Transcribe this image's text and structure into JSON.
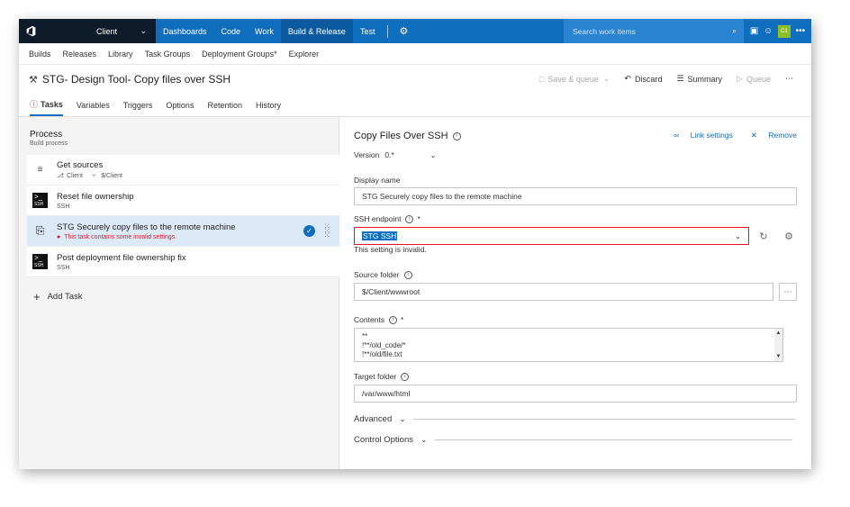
{
  "topbar": {
    "account": "Client",
    "nav": [
      "Dashboards",
      "Code",
      "Work",
      "Build & Release",
      "Test"
    ],
    "active_nav": "Build & Release",
    "search_placeholder": "Search work items",
    "avatar_initials": "C1"
  },
  "subnav": [
    "Builds",
    "Releases",
    "Library",
    "Task Groups",
    "Deployment Groups*",
    "Explorer"
  ],
  "definition": {
    "title": "STG- Design Tool- Copy files over SSH",
    "actions": {
      "save_queue": "Save & queue",
      "discard": "Discard",
      "summary": "Summary",
      "queue": "Queue"
    }
  },
  "tabs": [
    "Tasks",
    "Variables",
    "Triggers",
    "Options",
    "Retention",
    "History"
  ],
  "process": {
    "title": "Process",
    "subtitle": "Build process"
  },
  "tasks": [
    {
      "name": "Get sources",
      "sub_left": "Client",
      "sub_right": "$/Client"
    },
    {
      "name": "Reset file ownership",
      "sub": "SSH"
    },
    {
      "name": "STG Securely copy files to the remote machine",
      "error": "This task contains some invalid settings."
    },
    {
      "name": "Post deployment file ownership fix",
      "sub": "SSH"
    }
  ],
  "add_task": "Add Task",
  "detail": {
    "title": "Copy Files Over SSH",
    "link_settings": "Link settings",
    "remove": "Remove",
    "version_label": "Version",
    "version_value": "0.*",
    "display_name_label": "Display name",
    "display_name_value": "STG Securely copy files to the remote machine",
    "ssh_endpoint_label": "SSH endpoint",
    "ssh_endpoint_value": "STG SSH",
    "invalid_msg": "This setting is invalid.",
    "source_folder_label": "Source folder",
    "source_folder_value": "$/Client/wwwroot",
    "contents_label": "Contents",
    "contents_lines": [
      "**",
      "!**/old_code/*",
      "!**/old/file.txt"
    ],
    "target_folder_label": "Target folder",
    "target_folder_value": "/var/www/html",
    "advanced": "Advanced",
    "control_options": "Control Options",
    "required_marker": "*"
  }
}
